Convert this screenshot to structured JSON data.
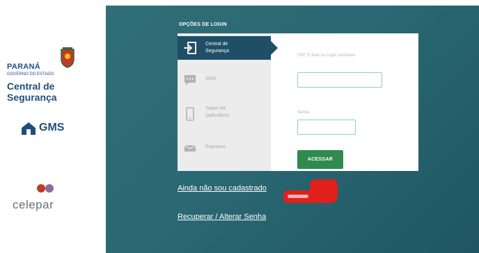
{
  "brand": {
    "state_name": "PARANÁ",
    "state_sub": "GOVERNO DO ESTADO",
    "app_title": "Central de Segurança",
    "gms_label": "GMS",
    "company": "celepar",
    "colors": {
      "teal": "#2a6873",
      "navy": "#1f4f66",
      "green": "#2f8a4f",
      "dot_red": "#c0392b",
      "dot_purple": "#8e6a9c"
    }
  },
  "login": {
    "heading": "OPÇÕES DE LOGIN",
    "options": [
      {
        "label": "Central de Segurança",
        "icon": "login-icon",
        "active": true
      },
      {
        "label": "SMS",
        "icon": "sms-icon",
        "active": false
      },
      {
        "label": "Token PA (aplicativo)",
        "icon": "phone-icon",
        "active": false
      },
      {
        "label": "Expresso",
        "icon": "mail-icon",
        "active": false
      }
    ],
    "user_label": "CPF, E-Mail ou Login Sentinela",
    "password_label": "Senha",
    "submit_label": "ACESSAR"
  },
  "links": {
    "register": "Ainda não sou cadastrado",
    "recover": "Recuperar / Alterar Senha"
  },
  "annotation": {
    "icon": "pointing-hand-icon",
    "color": "#e0201b"
  }
}
